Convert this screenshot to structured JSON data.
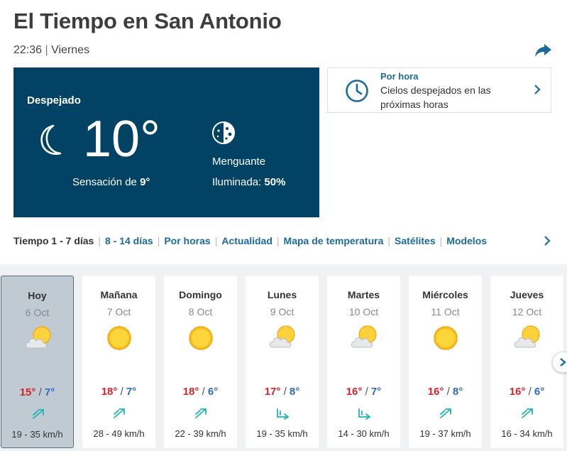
{
  "header": {
    "title": "El Tiempo en San Antonio",
    "time": "22:36",
    "separator": "|",
    "weekday": "Viernes",
    "share_icon": "share-arrow-icon"
  },
  "current": {
    "condition": "Despejado",
    "temperature": "10°",
    "feels_like_label": "Sensación de",
    "feels_like_value": "9°",
    "moon_phase": "Menguante",
    "illumination_label": "Iluminada:",
    "illumination_value": "50%",
    "icons": [
      "crescent-moon-icon",
      "moon-phase-icon"
    ],
    "bg_color": "#024264"
  },
  "hourly": {
    "title": "Por hora",
    "description": "Cielos despejados en las próximas horas",
    "icon": "clock-icon"
  },
  "tabs": [
    {
      "label": "Tiempo 1 - 7 días",
      "active": true
    },
    {
      "label": "8 - 14 días",
      "active": false
    },
    {
      "label": "Por horas",
      "active": false
    },
    {
      "label": "Actualidad",
      "active": false
    },
    {
      "label": "Mapa de temperatura",
      "active": false
    },
    {
      "label": "Satélites",
      "active": false
    },
    {
      "label": "Modelos",
      "active": false
    }
  ],
  "days": [
    {
      "name": "Hoy",
      "date": "6 Oct",
      "icon": "partly-cloudy-icon",
      "max": "15°",
      "min": "7°",
      "wind": "19 - 35 km/h",
      "wind_icon": "wind-northeast-icon"
    },
    {
      "name": "Mañana",
      "date": "7 Oct",
      "icon": "sun-icon",
      "max": "18°",
      "min": "7°",
      "wind": "28 - 49 km/h",
      "wind_icon": "wind-northeast-icon"
    },
    {
      "name": "Domingo",
      "date": "8 Oct",
      "icon": "sun-icon",
      "max": "18°",
      "min": "6°",
      "wind": "22 - 39 km/h",
      "wind_icon": "wind-northeast-icon"
    },
    {
      "name": "Lunes",
      "date": "9 Oct",
      "icon": "partly-cloudy-icon",
      "max": "17°",
      "min": "8°",
      "wind": "19 - 35 km/h",
      "wind_icon": "wind-east-icon"
    },
    {
      "name": "Martes",
      "date": "10 Oct",
      "icon": "partly-cloudy-icon",
      "max": "16°",
      "min": "7°",
      "wind": "14 - 30 km/h",
      "wind_icon": "wind-east-icon"
    },
    {
      "name": "Miércoles",
      "date": "11 Oct",
      "icon": "sun-icon",
      "max": "16°",
      "min": "8°",
      "wind": "19 - 37 km/h",
      "wind_icon": "wind-northeast-icon"
    },
    {
      "name": "Jueves",
      "date": "12 Oct",
      "icon": "partly-cloudy-icon",
      "max": "16°",
      "min": "6°",
      "wind": "16 - 34 km/h",
      "wind_icon": "wind-northeast-icon"
    }
  ],
  "colors": {
    "max_temp": "#d1242b",
    "min_temp": "#2d6cbd",
    "link": "#1d6a9c",
    "wind": "#1fb5b0"
  }
}
